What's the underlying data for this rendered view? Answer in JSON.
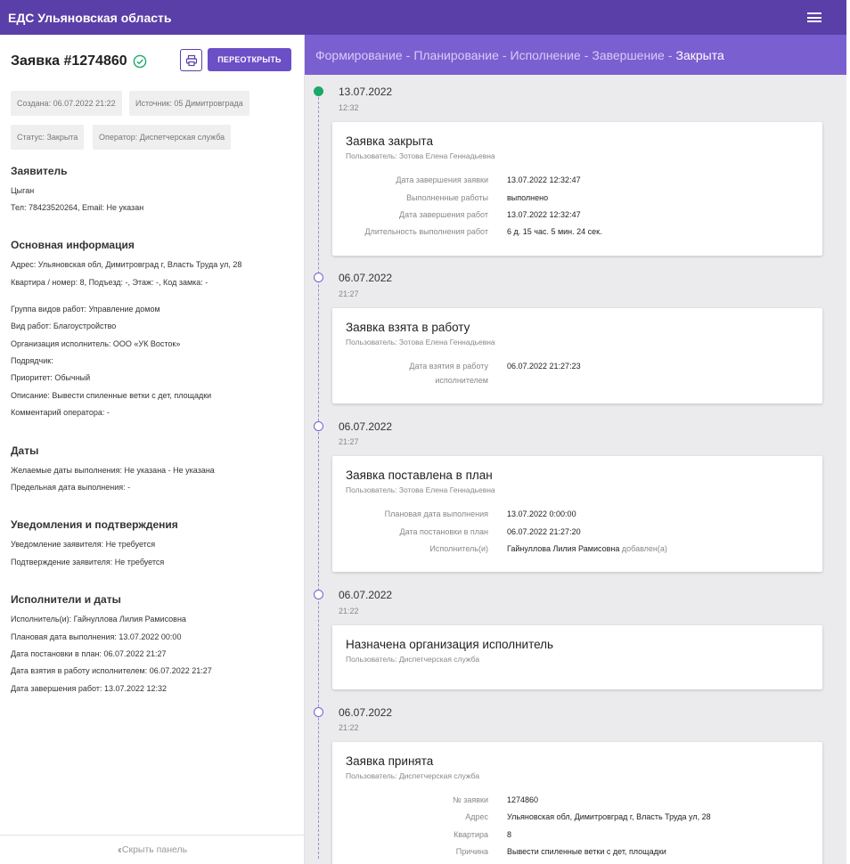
{
  "app": {
    "title": "ЕДС Ульяновская область"
  },
  "request": {
    "title": "Заявка #1274860",
    "reopen_label": "ПЕРЕОТКРЫТЬ",
    "chips": {
      "created": "Создана: 06.07.2022 21:22",
      "source": "Источник: 05 Димитровграда",
      "status": "Статус: Закрыта",
      "operator": "Оператор: Диспетчерская служба"
    }
  },
  "applicant": {
    "title": "Заявитель",
    "name": "Цыган",
    "contacts": "Тел: 78423520264, Email: Не указан"
  },
  "main_info": {
    "title": "Основная информация",
    "address": "Адрес: Ульяновская обл, Димитровград г, Власть Труда ул, 28",
    "apartment": "Квартира / номер: 8, Подъезд: -, Этаж: -, Код замка: -",
    "work_group": "Группа видов работ: Управление домом",
    "work_type": "Вид работ: Благоустройство",
    "org": "Организация исполнитель: ООО «УК Восток»",
    "contractor": "Подрядчик:",
    "priority": "Приоритет: Обычный",
    "description": "Описание: Вывести спиленные ветки с дет, площадки",
    "comment": "Комментарий оператора: -"
  },
  "dates": {
    "title": "Даты",
    "desired": "Желаемые даты выполнения: Не указана - Не указана",
    "deadline": "Предельная дата выполнения: -"
  },
  "notifications": {
    "title": "Уведомления и подтверждения",
    "notify": "Уведомление заявителя: Не требуется",
    "confirm": "Подтверждение заявителя: Не требуется"
  },
  "executors": {
    "title": "Исполнители и даты",
    "executor": "Исполнитель(и): Гайнуллова Лилия Рамисовна",
    "planned": "Плановая дата выполнения: 13.07.2022 00:00",
    "planned_set": "Дата постановки в план: 06.07.2022 21:27",
    "taken": "Дата взятия в работу исполнителем: 06.07.2022 21:27",
    "finished": "Дата завершения работ: 13.07.2022 12:32"
  },
  "collapse_label": "Скрыть панель",
  "stages": {
    "items": [
      "Формирование",
      "Планирование",
      "Исполнение",
      "Завершение"
    ],
    "current": "Закрыта",
    "separator": "-"
  },
  "timeline": [
    {
      "date": "13.07.2022",
      "time": "12:32",
      "title": "Заявка закрыта",
      "user": "Пользователь: Зотова Елена Геннадьевна",
      "rows": [
        {
          "k": "Дата завершения заявки",
          "v": "13.07.2022 12:32:47"
        },
        {
          "k": "Выполненные работы",
          "v": "выполнено"
        },
        {
          "k": "Дата завершения работ",
          "v": "13.07.2022 12:32:47"
        },
        {
          "k": "Длительность выполнения работ",
          "v": "6 д. 15 час. 5 мин. 24 сек."
        }
      ]
    },
    {
      "date": "06.07.2022",
      "time": "21:27",
      "title": "Заявка взята в работу",
      "user": "Пользователь: Зотова Елена Геннадьевна",
      "rows": [
        {
          "k1": "Дата взятия в работу",
          "k2": "исполнителем",
          "v": "06.07.2022 21:27:23"
        }
      ]
    },
    {
      "date": "06.07.2022",
      "time": "21:27",
      "title": "Заявка поставлена в план",
      "user": "Пользователь: Зотова Елена Геннадьевна",
      "rows": [
        {
          "k": "Плановая дата выполнения",
          "v": "13.07.2022 0:00:00"
        },
        {
          "k": "Дата постановки в план",
          "v": "06.07.2022 21:27:20"
        },
        {
          "k": "Исполнитель(и)",
          "v": "Гайнуллова Лилия Рамисовна",
          "suffix": "добавлен(а)"
        }
      ]
    },
    {
      "date": "06.07.2022",
      "time": "21:22",
      "title": "Назначена организация исполнитель",
      "user": "Пользователь: Диспетчерская служба",
      "rows": []
    },
    {
      "date": "06.07.2022",
      "time": "21:22",
      "title": "Заявка принята",
      "user": "Пользователь: Диспетчерская служба",
      "rows": [
        {
          "k": "№ заявки",
          "v": "1274860"
        },
        {
          "k": "Адрес",
          "v": "Ульяновская обл, Димитровград г, Власть Труда ул, 28"
        },
        {
          "k": "Квартира",
          "v": "8"
        },
        {
          "k": "Причина",
          "v": "Вывести спиленные ветки с дет, площадки"
        }
      ]
    }
  ],
  "colors": {
    "header": "#5b3fa8",
    "accent": "#6a4fc6",
    "stages_bg": "#7a5fd1",
    "done": "#1ba868"
  }
}
